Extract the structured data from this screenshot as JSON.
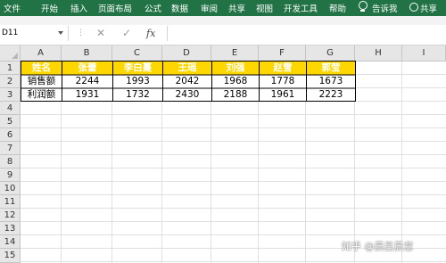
{
  "ribbon": {
    "tabs": [
      "文件",
      "开始",
      "插入",
      "页面布局",
      "公式",
      "数据",
      "审阅",
      "共享",
      "视图",
      "开发工具",
      "帮助"
    ],
    "tell_me": "告诉我",
    "share": "共享"
  },
  "formula_bar": {
    "name_box": "D11",
    "fx": "fx",
    "cancel": "✕",
    "enter": "✓",
    "formula": ""
  },
  "columns": [
    "A",
    "B",
    "C",
    "D",
    "E",
    "F",
    "G",
    "H",
    "I"
  ],
  "rows": [
    "1",
    "2",
    "3",
    "4",
    "5",
    "6",
    "7",
    "8",
    "9",
    "10",
    "11",
    "12",
    "13",
    "14",
    "15"
  ],
  "table": {
    "header": [
      "姓名",
      "张蕾",
      "李白蔓",
      "王瑶",
      "刘强",
      "赵雪",
      "郭莹"
    ],
    "rows": [
      [
        "销售额",
        "2244",
        "1993",
        "2042",
        "1968",
        "1778",
        "1673"
      ],
      [
        "利润额",
        "1931",
        "1732",
        "2430",
        "2188",
        "1961",
        "2223"
      ]
    ]
  },
  "colors": {
    "ribbon": "#217346",
    "header_fill": "#ffd700"
  },
  "watermark": "知乎 @晨星晨意"
}
